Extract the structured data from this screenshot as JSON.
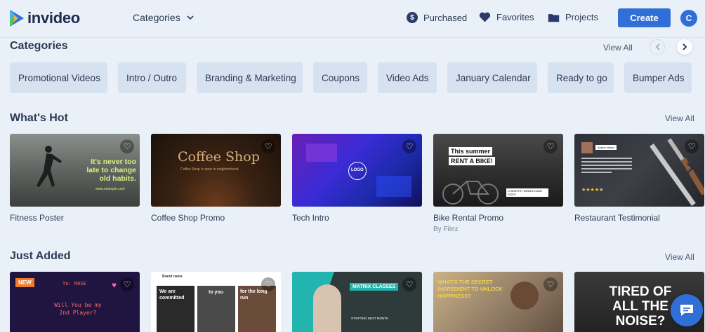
{
  "header": {
    "logo_text": "invideo",
    "categories_label": "Categories",
    "purchased_label": "Purchased",
    "favorites_label": "Favorites",
    "projects_label": "Projects",
    "create_label": "Create",
    "avatar_letter": "C"
  },
  "categories": {
    "title": "Categories",
    "view_all": "View All",
    "chips": [
      "Promotional Videos",
      "Intro / Outro",
      "Branding & Marketing",
      "Coupons",
      "Video Ads",
      "January Calendar",
      "Ready to go",
      "Bumper Ads"
    ]
  },
  "whats_hot": {
    "title": "What's Hot",
    "view_all": "View All",
    "cards": [
      {
        "title": "Fitness Poster",
        "subtitle": "",
        "thumb_text": [
          "It's never too",
          "late to change",
          "old habits."
        ],
        "thumb_small": "www.example.com"
      },
      {
        "title": "Coffee Shop Promo",
        "subtitle": "",
        "thumb_text": [
          "Coffee Shop"
        ],
        "thumb_small": "Coffee Shop is open in neighborhood"
      },
      {
        "title": "Tech Intro",
        "subtitle": "",
        "thumb_text": [
          "LOGO"
        ],
        "thumb_small": ""
      },
      {
        "title": "Bike Rental Promo",
        "subtitle": "By Filez",
        "thumb_text": [
          "This summer",
          "RENT A BIKE!"
        ],
        "thumb_small": "CHEAPEST MODELS AND SIZES"
      },
      {
        "title": "Restaurant Testimonial",
        "subtitle": "",
        "thumb_text": [
          "★★★★★"
        ],
        "thumb_small": "Author Name"
      }
    ]
  },
  "just_added": {
    "title": "Just Added",
    "view_all": "View All",
    "cards": [
      {
        "badge": "NEW",
        "thumb_text": [
          "Will You be my",
          "2nd Player?"
        ],
        "thumb_small": "To: ROSE"
      },
      {
        "thumb_text": [
          "We are",
          "committed",
          "to you",
          "for the long",
          "run"
        ],
        "thumb_small": "Brand name"
      },
      {
        "thumb_text": [
          "MATRIX CLASSES"
        ],
        "thumb_small": "STARTING NEXT MONTH"
      },
      {
        "thumb_text": [
          "WHAT'S THE SECRET",
          "INGREDIENT TO UNLOCK",
          "HAPPINESS?"
        ],
        "thumb_small": ""
      },
      {
        "thumb_text": [
          "TIRED OF",
          "ALL THE",
          "NOISE?"
        ],
        "thumb_small": ""
      }
    ]
  },
  "colors": {
    "accent": "#2f6fd6",
    "background": "#eaf0f8",
    "chip": "#d7e2f0"
  }
}
